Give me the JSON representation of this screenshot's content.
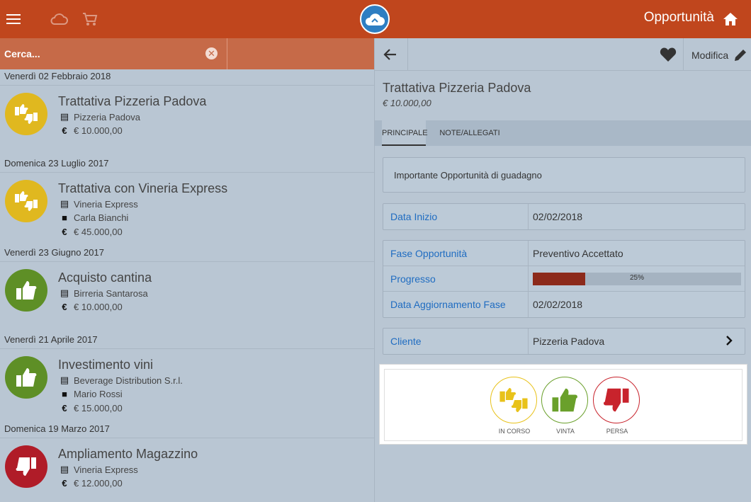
{
  "header": {
    "title": "Opportunità",
    "icons": [
      "menu-icon",
      "cloud-icon",
      "cart-icon",
      "app-logo",
      "home-icon"
    ]
  },
  "search": {
    "placeholder": "Cerca..."
  },
  "list": {
    "groups": [
      {
        "date": "Venerdì 02 Febbraio 2018",
        "title": "Trattativa Pizzeria Padova",
        "status": "in-corso",
        "company": "Pizzeria Padova",
        "contact": "",
        "amount": "€ 10.000,00"
      },
      {
        "date": "Domenica 23 Luglio 2017",
        "title": "Trattativa con Vineria Express",
        "status": "in-corso",
        "company": "Vineria Express",
        "contact": "Carla Bianchi",
        "amount": "€ 45.000,00"
      },
      {
        "date": "Venerdì 23 Giugno 2017",
        "title": "Acquisto cantina",
        "status": "vinta",
        "company": "Birreria Santarosa",
        "contact": "",
        "amount": "€ 10.000,00"
      },
      {
        "date": "Venerdì 21 Aprile 2017",
        "title": "Investimento vini",
        "status": "vinta",
        "company": "Beverage Distribution S.r.l.",
        "contact": "Mario Rossi",
        "amount": "€ 15.000,00"
      },
      {
        "date": "Domenica 19 Marzo 2017",
        "title": "Ampliamento Magazzino",
        "status": "persa",
        "company": "Vineria Express",
        "contact": "",
        "amount": "€ 12.000,00"
      }
    ]
  },
  "detail": {
    "edit_label": "Modifica",
    "title": "Trattativa Pizzeria Padova",
    "amount": "€ 10.000,00",
    "tabs": [
      "PRINCIPALE",
      "NOTE/ALLEGATI"
    ],
    "description": "Importante Opportunità di guadagno",
    "data_inizio_label": "Data Inizio",
    "data_inizio": "02/02/2018",
    "fase_label": "Fase Opportunità",
    "fase": "Preventivo Accettato",
    "progresso_label": "Progresso",
    "progresso_text": "25%",
    "progresso_value": 0.25,
    "data_agg_label": "Data Aggiornamento Fase",
    "data_agg": "02/02/2018",
    "cliente_label": "Cliente",
    "cliente": "Pizzeria Padova",
    "status_buttons": [
      "IN CORSO",
      "VINTA",
      "PERSA"
    ]
  },
  "colors": {
    "header": "#c0461d",
    "search": "#c66a48",
    "in_corso": "#e8c21a",
    "vinta": "#6aa02b",
    "persa": "#c8232c",
    "link": "#1f6cc1",
    "progress": "#8c2a1b"
  }
}
